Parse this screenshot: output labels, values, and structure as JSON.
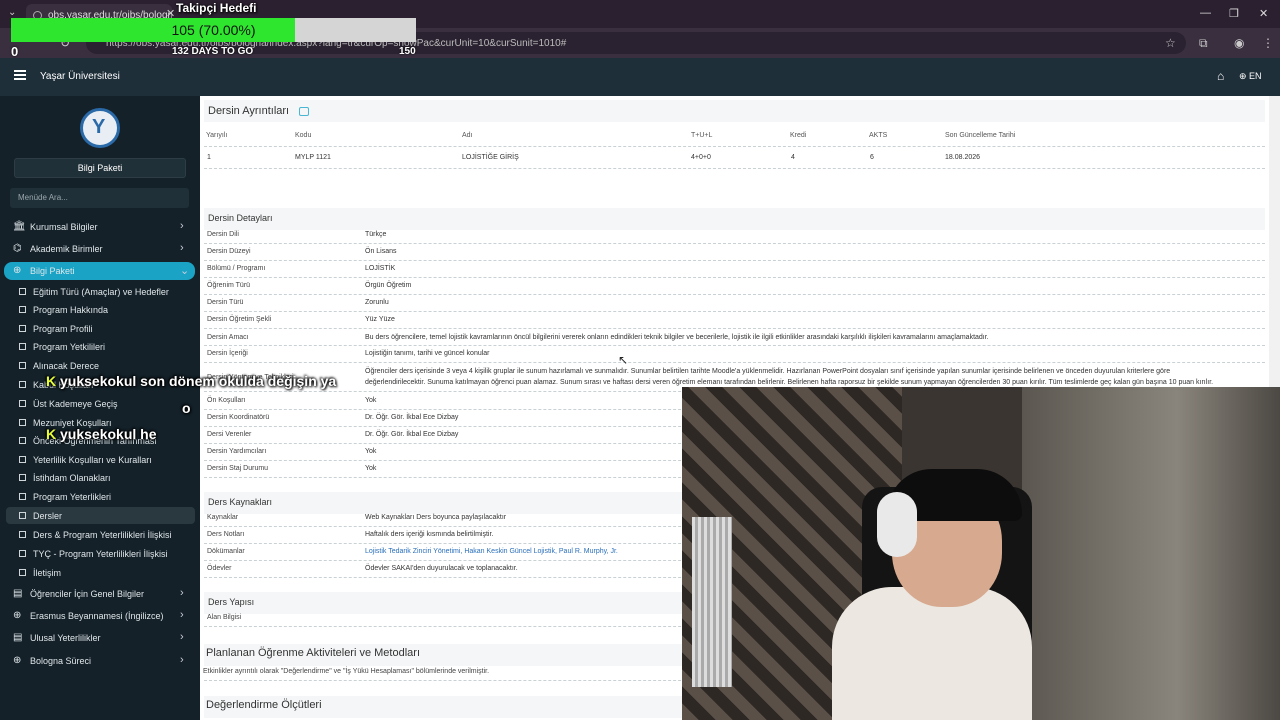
{
  "browser": {
    "tab_title": "obs.yasar.edu.tr/oibs/bologna/",
    "url": "https://obs.yasar.edu.tr/oibs/bologna/index.aspx?lang=tr&curOp=showPac&curUnit=10&curSunit=1010#"
  },
  "stream": {
    "goal_title": "Takipçi Hedefi",
    "goal_text": "105 (70.00%)",
    "goal_fraction": 0.7,
    "goal_min": "0",
    "goal_days": "132 DAYS TO GO",
    "goal_max": "150",
    "chat": [
      {
        "k": "K",
        "user": "yuksekokul",
        "msg": "son dönem okulda değişin ya"
      },
      {
        "k": "",
        "user": "",
        "msg": "o"
      },
      {
        "k": "K",
        "user": "yuksekokul",
        "msg": "he"
      }
    ],
    "colors": {
      "goal_fill": "#2ee62e",
      "chat_badge": "#e6ff3a"
    }
  },
  "app": {
    "title": "Yaşar Üniversitesi",
    "lang": "EN",
    "accent": "#1aa3c4"
  },
  "sidebar": {
    "package_button": "Bilgi Paketi",
    "search_placeholder": "Menüde Ara...",
    "items": [
      {
        "icon": "institution-icon",
        "label": "Kurumsal Bilgiler"
      },
      {
        "icon": "academic-units-icon",
        "label": "Akademik Birimler"
      },
      {
        "icon": "globe-icon",
        "label": "Bilgi Paketi"
      }
    ],
    "subitems": [
      "Eğitim Türü (Amaçlar) ve Hedefler",
      "Program Hakkında",
      "Program Profili",
      "Program Yetkilileri",
      "Alınacak Derece",
      "Kabul Koşulları",
      "Üst Kademeye Geçiş",
      "Mezuniyet Koşulları",
      "Önceki Öğrenmenin Tanınması",
      "Yeterlilik Koşulları ve Kuralları",
      "İstihdam Olanakları",
      "Program Yeterlikleri",
      "Dersler",
      "Ders & Program Yeterlilikleri İlişkisi",
      "TYÇ - Program Yeterlilikleri İlişkisi",
      "İletişim"
    ],
    "items_bottom": [
      {
        "icon": "book-icon",
        "label": "Öğrenciler İçin Genel Bilgiler"
      },
      {
        "icon": "globe-icon",
        "label": "Erasmus Beyannamesi (İngilizce)"
      },
      {
        "icon": "book-icon",
        "label": "Ulusal Yeterlilikler"
      },
      {
        "icon": "globe-icon",
        "label": "Bologna Süreci"
      }
    ]
  },
  "course": {
    "panel_title": "Dersin Ayrıntıları",
    "headers": [
      "Yarıyılı",
      "Kodu",
      "Adı",
      "T+U+L",
      "Kredi",
      "AKTS",
      "Son Güncelleme Tarihi"
    ],
    "row": [
      "1",
      "MYLP 1121",
      "LOJİSTİĞE GİRİŞ",
      "4+0+0",
      "4",
      "6",
      "18.08.2026"
    ]
  },
  "details": {
    "title": "Dersin Detayları",
    "rows": [
      {
        "label": "Dersin Dili",
        "value": "Türkçe"
      },
      {
        "label": "Dersin Düzeyi",
        "value": "Ön Lisans"
      },
      {
        "label": "Bölümü / Programı",
        "value": "LOJİSTİK"
      },
      {
        "label": "Öğrenim Türü",
        "value": "Örgün Öğretim"
      },
      {
        "label": "Dersin Türü",
        "value": "Zorunlu"
      },
      {
        "label": "Dersin Öğretim Şekli",
        "value": "Yüz Yüze"
      },
      {
        "label": "Dersin Amacı",
        "value": "Bu ders öğrencilere, temel lojistik kavramlarının öncül bilgilerini vererek onların edindikleri teknik bilgiler ve becerilerle, lojistik ile ilgili etkinlikler arasındaki karşılıklı ilişkileri kavramalarını amaçlamaktadır."
      },
      {
        "label": "Dersin İçeriği",
        "value": "Lojistiğin tanımı, tarihi ve güncel konular"
      },
      {
        "label": "Dersin Yöntem ve Teknikleri",
        "value": "Öğrenciler ders içerisinde 3 veya 4 kişilik gruplar ile sunum hazırlamalı ve sunmalıdır. Sunumlar belirtilen tarihte Moodle'a yüklenmelidir. Hazırlanan PowerPoint dosyaları sınıf içerisinde yapılan sunumlar içerisinde belirlenen ve önceden duyurulan kriterlere göre"
      },
      {
        "label": "",
        "value": "değerlendirilecektir. Sunuma katılmayan öğrenci puan alamaz. Sunum sırası ve haftası dersi veren öğretim elemanı tarafından belirlenir. Belirlenen hafta raporsuz bir şekilde sunum yapmayan öğrencilerden 30 puan kırılır. Tüm teslimlerde geç kalan gün başına 10 puan kırılır."
      },
      {
        "label": "Ön Koşulları",
        "value": "Yok"
      },
      {
        "label": "Dersin Koordinatörü",
        "value": "Dr. Öğr. Gör. İkbal Ece Dizbay"
      },
      {
        "label": "Dersi Verenler",
        "value": "Dr. Öğr. Gör. İkbal Ece Dizbay"
      },
      {
        "label": "Dersin Yardımcıları",
        "value": "Yok"
      },
      {
        "label": "Dersin Staj Durumu",
        "value": "Yok"
      }
    ]
  },
  "resources": {
    "title": "Ders Kaynakları",
    "rows": [
      {
        "label": "Kaynaklar",
        "value": "Web Kaynakları Ders boyunca paylaşılacaktır"
      },
      {
        "label": "Ders Notları",
        "value": "Haftalık ders içeriği kısmında belirtilmiştir."
      },
      {
        "label": "Dökümanlar",
        "value": "Lojistik Tedarik Zinciri Yönetimi, Hakan Keskin Güncel Lojistik, Paul R. Murphy, Jr."
      },
      {
        "label": "Ödevler",
        "value": "Ödevler SAKAI'den duyurulacak ve toplanacaktır."
      }
    ]
  },
  "structure": {
    "title": "Ders Yapısı",
    "label": "Alan Bilgisi"
  },
  "planned": {
    "title": "Planlanan Öğrenme Aktiviteleri ve Metodları",
    "text": "Etkinlikler ayrıntılı olarak \"Değerlendirme\" ve \"İş Yükü Hesaplaması\" bölümlerinde verilmiştir."
  },
  "evaluation": {
    "title": "Değerlendirme Ölçütleri"
  }
}
